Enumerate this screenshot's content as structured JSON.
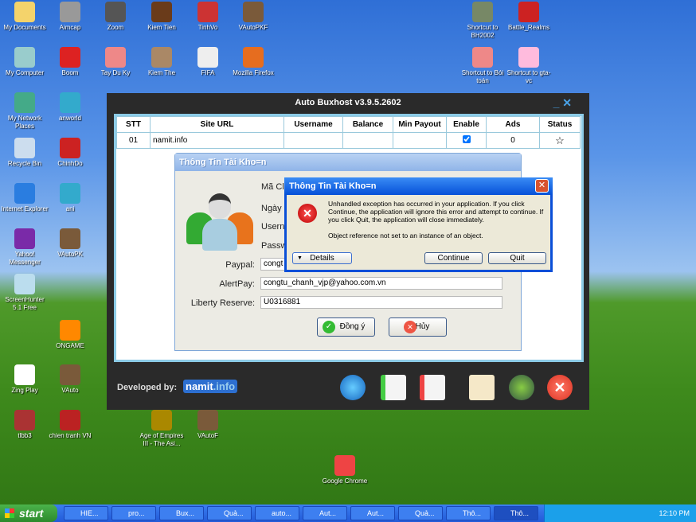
{
  "desktop": {
    "icons": [
      {
        "label": "My Documents",
        "color": "#f4d36b"
      },
      {
        "label": "Aimcap",
        "color": "#999"
      },
      {
        "label": "Zoom",
        "color": "#555"
      },
      {
        "label": "Kiem Tien",
        "color": "#6a3b1a"
      },
      {
        "label": "TinhVo",
        "color": "#c33"
      },
      {
        "label": "VAutoPKF",
        "color": "#7a5a3a"
      },
      {
        "label": "My Computer",
        "color": "#9cc"
      },
      {
        "label": "Boom",
        "color": "#d22"
      },
      {
        "label": "Tay Du Ky",
        "color": "#e88"
      },
      {
        "label": "Kiem The",
        "color": "#a86"
      },
      {
        "label": "FIFA",
        "color": "#eee"
      },
      {
        "label": "Mozilla Firefox",
        "color": "#e66d1f"
      },
      {
        "label": "My Network Places",
        "color": "#4a8"
      },
      {
        "label": "anworld",
        "color": "#3ac"
      },
      {
        "label": "Recycle Bin",
        "color": "#cde"
      },
      {
        "label": "ChinhDo",
        "color": "#c22"
      },
      {
        "label": "Internet Explorer",
        "color": "#2a7de0"
      },
      {
        "label": "ani",
        "color": "#3ac"
      },
      {
        "label": "Yahoo! Messenger",
        "color": "#7a2aa8"
      },
      {
        "label": "VAutoPK",
        "color": "#7a5a3a"
      },
      {
        "label": "ScreenHunter 5.1 Free",
        "color": "#bde"
      },
      {
        "label": "ONGAME",
        "color": "#f80"
      },
      {
        "label": "Zing Play",
        "color": "#fff"
      },
      {
        "label": "VAuto",
        "color": "#7a5a3a"
      },
      {
        "label": "tlbb3",
        "color": "#a33"
      },
      {
        "label": "chien tranh VN",
        "color": "#b22"
      },
      {
        "label": "Age of Empires III - The Asi...",
        "color": "#a80"
      },
      {
        "label": "VAutoF",
        "color": "#7a5a3a"
      },
      {
        "label": "Google Chrome",
        "color": "#e44"
      },
      {
        "label": "Shortcut to BH2002",
        "color": "#786"
      },
      {
        "label": "Battle_Realms",
        "color": "#c22"
      },
      {
        "label": "Shortcut to Bói toán",
        "color": "#e88"
      },
      {
        "label": "Shortcut to gta-vc",
        "color": "#fbd"
      }
    ]
  },
  "app": {
    "title": "Auto Buxhost v3.9.5.2602",
    "min": "_",
    "close": "✕",
    "columns": [
      "STT",
      "Site URL",
      "Username",
      "Balance",
      "Min Payout",
      "Enable",
      "Ads",
      "Status"
    ],
    "rows": [
      {
        "stt": "01",
        "url": "namit.info",
        "username": "",
        "balance": "",
        "min_payout": "",
        "enabled": true,
        "ads": "0",
        "status": "☆"
      }
    ],
    "developed_by": "Developed by:",
    "brand": "namit",
    "brand_suffix": ".info"
  },
  "account_dialog": {
    "title": "Thông Tin Tài Kho=n",
    "labels": {
      "client": "Mã Cli",
      "date": "Ngày I",
      "user": "Usern",
      "pass": "Passw",
      "paypal": "Paypal:",
      "alertpay": "AlertPay:",
      "liberty": "Liberty Reserve:"
    },
    "values": {
      "paypal": "congt",
      "alertpay": "congtu_chanh_vjp@yahoo.com.vn",
      "liberty": "U0316881"
    },
    "ok": "Đồng ý",
    "cancel": "Hủy"
  },
  "error_dialog": {
    "title": "Thông Tin Tài Kho=n",
    "message": "Unhandled exception has occurred in your application. If you click Continue, the application will ignore this error and attempt to continue. If you click Quit, the application will close immediately.",
    "detail": "Object reference not set to an instance of an object.",
    "details": "Details",
    "continue": "Continue",
    "quit": "Quit",
    "close": "✕"
  },
  "taskbar": {
    "start": "start",
    "tasks": [
      "HIE...",
      "pro...",
      "Bux...",
      "Quả...",
      "auto...",
      "Aut...",
      "Aut...",
      "Quả...",
      "Thô...",
      "Thô..."
    ],
    "clock": "12:10 PM"
  }
}
